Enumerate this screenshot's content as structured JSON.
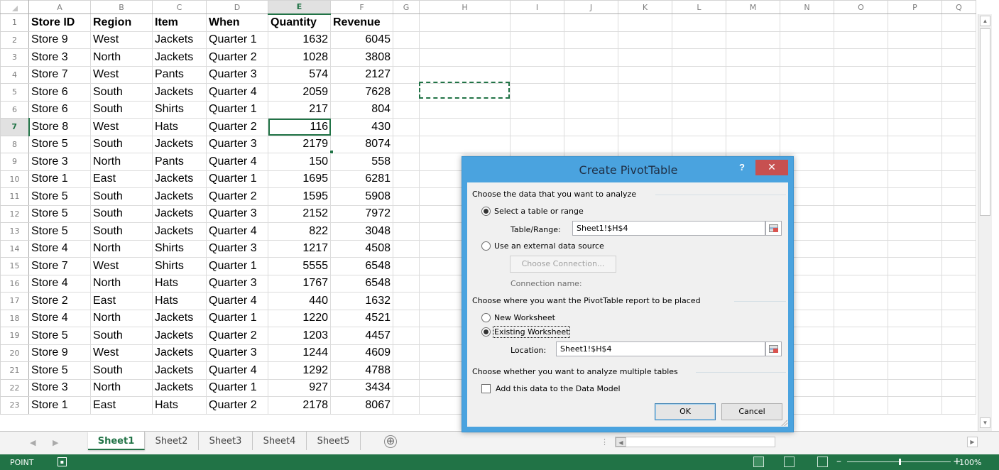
{
  "sheet": {
    "columns": [
      "A",
      "B",
      "C",
      "D",
      "E",
      "F",
      "G",
      "H",
      "I",
      "J",
      "K",
      "L",
      "M",
      "N",
      "O",
      "P",
      "Q"
    ],
    "selected_column": "E",
    "selected_row": "7",
    "rows": [
      {
        "n": "1",
        "cells": [
          "Store ID",
          "Region",
          "Item",
          "When",
          "Quantity",
          "Revenue"
        ]
      },
      {
        "n": "2",
        "cells": [
          "Store 9",
          "West",
          "Jackets",
          "Quarter 1",
          "1632",
          "6045"
        ]
      },
      {
        "n": "3",
        "cells": [
          "Store 3",
          "North",
          "Jackets",
          "Quarter 2",
          "1028",
          "3808"
        ]
      },
      {
        "n": "4",
        "cells": [
          "Store 7",
          "West",
          "Pants",
          "Quarter 3",
          "574",
          "2127"
        ]
      },
      {
        "n": "5",
        "cells": [
          "Store 6",
          "South",
          "Jackets",
          "Quarter 4",
          "2059",
          "7628"
        ]
      },
      {
        "n": "6",
        "cells": [
          "Store 6",
          "South",
          "Shirts",
          "Quarter 1",
          "217",
          "804"
        ]
      },
      {
        "n": "7",
        "cells": [
          "Store 8",
          "West",
          "Hats",
          "Quarter 2",
          "116",
          "430"
        ]
      },
      {
        "n": "8",
        "cells": [
          "Store 5",
          "South",
          "Jackets",
          "Quarter 3",
          "2179",
          "8074"
        ]
      },
      {
        "n": "9",
        "cells": [
          "Store 3",
          "North",
          "Pants",
          "Quarter 4",
          "150",
          "558"
        ]
      },
      {
        "n": "10",
        "cells": [
          "Store 1",
          "East",
          "Jackets",
          "Quarter 1",
          "1695",
          "6281"
        ]
      },
      {
        "n": "11",
        "cells": [
          "Store 5",
          "South",
          "Jackets",
          "Quarter 2",
          "1595",
          "5908"
        ]
      },
      {
        "n": "12",
        "cells": [
          "Store 5",
          "South",
          "Jackets",
          "Quarter 3",
          "2152",
          "7972"
        ]
      },
      {
        "n": "13",
        "cells": [
          "Store 5",
          "South",
          "Jackets",
          "Quarter 4",
          "822",
          "3048"
        ]
      },
      {
        "n": "14",
        "cells": [
          "Store 4",
          "North",
          "Shirts",
          "Quarter 3",
          "1217",
          "4508"
        ]
      },
      {
        "n": "15",
        "cells": [
          "Store 7",
          "West",
          "Shirts",
          "Quarter 1",
          "5555",
          "6548"
        ]
      },
      {
        "n": "16",
        "cells": [
          "Store 4",
          "North",
          "Hats",
          "Quarter 3",
          "1767",
          "6548"
        ]
      },
      {
        "n": "17",
        "cells": [
          "Store 2",
          "East",
          "Hats",
          "Quarter 4",
          "440",
          "1632"
        ]
      },
      {
        "n": "18",
        "cells": [
          "Store 4",
          "North",
          "Jackets",
          "Quarter 1",
          "1220",
          "4521"
        ]
      },
      {
        "n": "19",
        "cells": [
          "Store 5",
          "South",
          "Jackets",
          "Quarter 2",
          "1203",
          "4457"
        ]
      },
      {
        "n": "20",
        "cells": [
          "Store 9",
          "West",
          "Jackets",
          "Quarter 3",
          "1244",
          "4609"
        ]
      },
      {
        "n": "21",
        "cells": [
          "Store 5",
          "South",
          "Jackets",
          "Quarter 4",
          "1292",
          "4788"
        ]
      },
      {
        "n": "22",
        "cells": [
          "Store 3",
          "North",
          "Jackets",
          "Quarter 1",
          "927",
          "3434"
        ]
      },
      {
        "n": "23",
        "cells": [
          "Store 1",
          "East",
          "Hats",
          "Quarter 2",
          "2178",
          "8067"
        ]
      }
    ]
  },
  "tabs": {
    "sheets": [
      "Sheet1",
      "Sheet2",
      "Sheet3",
      "Sheet4",
      "Sheet5"
    ],
    "active": "Sheet1",
    "add_symbol": "⊕"
  },
  "status": {
    "mode": "POINT",
    "zoom": "100%"
  },
  "dialog": {
    "title": "Create PivotTable",
    "help": "?",
    "close": "✕",
    "section1": "Choose the data that you want to analyze",
    "option_table": "Select a table or range",
    "table_range_label": "Table/Range:",
    "table_range_value": "Sheet1!$H$4",
    "option_external": "Use an external data source",
    "choose_connection": "Choose Connection...",
    "connection_name_label": "Connection name:",
    "section2": "Choose where you want the PivotTable report to be placed",
    "option_new": "New Worksheet",
    "option_existing": "Existing Worksheet",
    "location_label": "Location:",
    "location_value": "Sheet1!$H$4",
    "section3": "Choose whether you want to analyze multiple tables",
    "data_model_label": "Add this data to the Data Model",
    "ok": "OK",
    "cancel": "Cancel",
    "selected_source": "table",
    "selected_placement": "existing",
    "data_model_checked": false
  },
  "colors": {
    "excel_green": "#217346",
    "dialog_frame": "#4aa3df",
    "close_red": "#c75050"
  }
}
